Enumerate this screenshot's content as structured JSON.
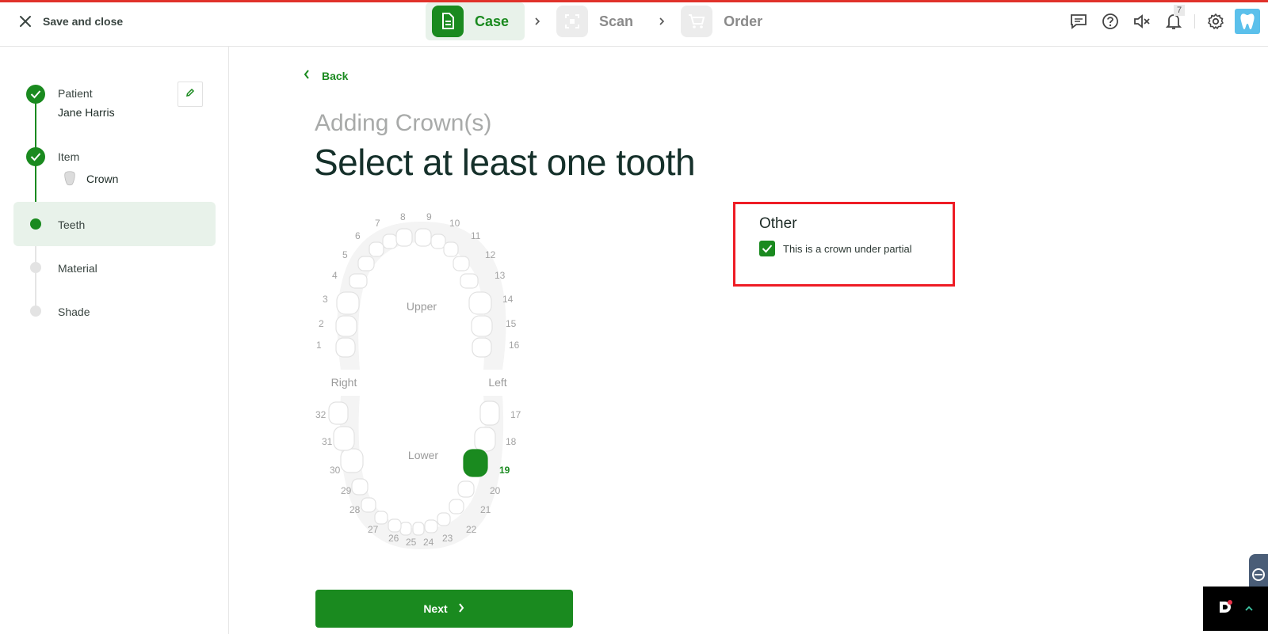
{
  "header": {
    "save_close_label": "Save and close",
    "steps": [
      {
        "label": "Case",
        "icon": "document-icon",
        "state": "active"
      },
      {
        "label": "Scan",
        "icon": "scan-icon",
        "state": "inactive"
      },
      {
        "label": "Order",
        "icon": "cart-icon",
        "state": "inactive"
      }
    ],
    "notification_count": "7",
    "icons": [
      "chat-icon",
      "help-icon",
      "mute-icon",
      "bell-icon",
      "gear-icon",
      "avatar"
    ]
  },
  "sidebar": {
    "patient_label": "Patient",
    "patient_name": "Jane Harris",
    "item_label": "Item",
    "item_value": "Crown",
    "teeth_label": "Teeth",
    "material_label": "Material",
    "shade_label": "Shade"
  },
  "main": {
    "back_label": "Back",
    "subtitle": "Adding Crown(s)",
    "title": "Select at least one tooth",
    "upper_label": "Upper",
    "lower_label": "Lower",
    "right_label": "Right",
    "left_label": "Left",
    "selected_teeth": [
      19
    ],
    "teeth_numbers": [
      "1",
      "2",
      "3",
      "4",
      "5",
      "6",
      "7",
      "8",
      "9",
      "10",
      "11",
      "12",
      "13",
      "14",
      "15",
      "16",
      "17",
      "18",
      "19",
      "20",
      "21",
      "22",
      "23",
      "24",
      "25",
      "26",
      "27",
      "28",
      "29",
      "30",
      "31",
      "32"
    ],
    "other_title": "Other",
    "other_checkbox_label": "This is a crown under partial",
    "other_checkbox_checked": true,
    "next_label": "Next"
  },
  "colors": {
    "brand_green": "#1a8a1f",
    "active_bg": "#e8f2ea",
    "highlight_red": "#ee1c25"
  }
}
